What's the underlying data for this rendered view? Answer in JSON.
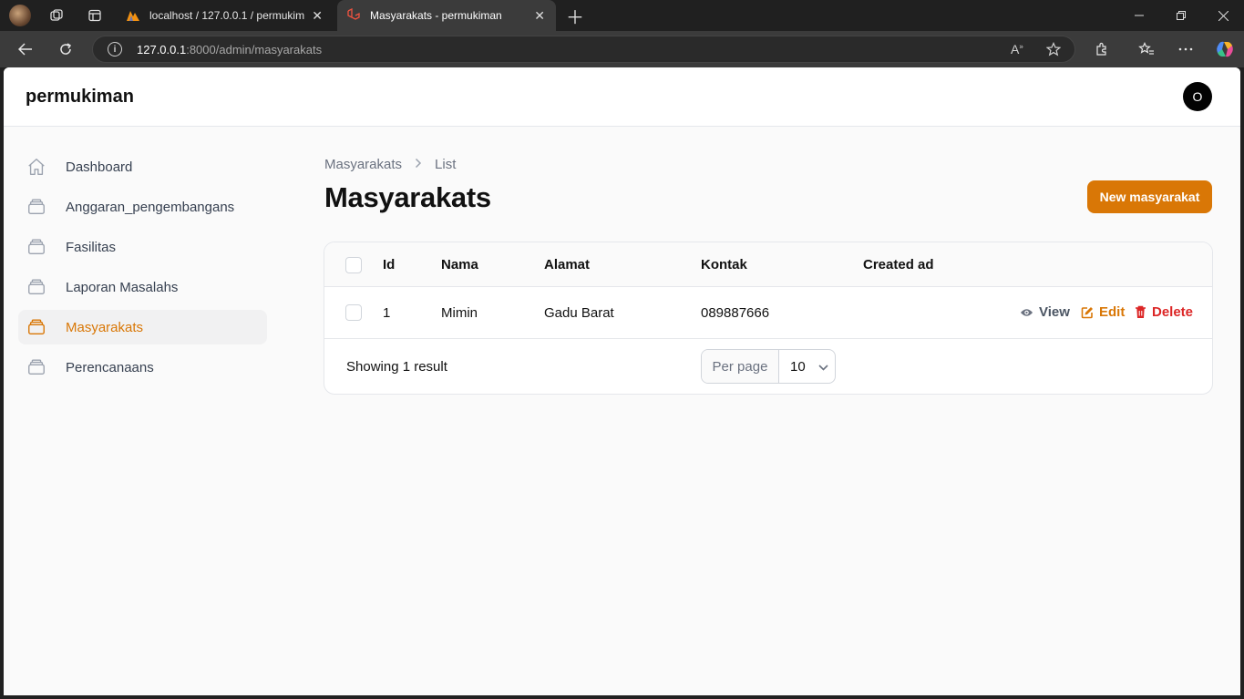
{
  "browser": {
    "tabs": [
      {
        "title": "localhost / 127.0.0.1 / permukiman",
        "active": false
      },
      {
        "title": "Masyarakats - permukiman",
        "active": true
      }
    ],
    "url_host": "127.0.0.1",
    "url_rest": ":8000/admin/masyarakats"
  },
  "app": {
    "brand": "permukiman",
    "avatar_initial": "O",
    "accent_color": "#d97706"
  },
  "sidebar": {
    "items": [
      {
        "label": "Dashboard",
        "icon": "home-icon",
        "active": false
      },
      {
        "label": "Anggaran_pengembangans",
        "icon": "collection-icon",
        "active": false
      },
      {
        "label": "Fasilitas",
        "icon": "collection-icon",
        "active": false
      },
      {
        "label": "Laporan Masalahs",
        "icon": "collection-icon",
        "active": false
      },
      {
        "label": "Masyarakats",
        "icon": "collection-icon",
        "active": true
      },
      {
        "label": "Perencanaans",
        "icon": "collection-icon",
        "active": false
      }
    ]
  },
  "breadcrumb": {
    "parent": "Masyarakats",
    "current": "List"
  },
  "page": {
    "title": "Masyarakats",
    "new_button": "New masyarakat"
  },
  "table": {
    "columns": [
      "Id",
      "Nama",
      "Alamat",
      "Kontak",
      "Created ad"
    ],
    "rows": [
      {
        "id": "1",
        "nama": "Mimin",
        "alamat": "Gadu Barat",
        "kontak": "089887666",
        "created_ad": ""
      }
    ],
    "actions": {
      "view": "View",
      "edit": "Edit",
      "delete": "Delete"
    },
    "footer": {
      "showing": "Showing 1 result",
      "per_page_label": "Per page",
      "per_page_value": "10"
    }
  }
}
